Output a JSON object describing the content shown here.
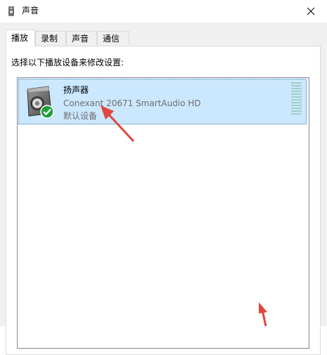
{
  "window": {
    "title": "声音"
  },
  "tabs": [
    {
      "label": "播放",
      "active": true
    },
    {
      "label": "录制",
      "active": false
    },
    {
      "label": "声音",
      "active": false
    },
    {
      "label": "通信",
      "active": false
    }
  ],
  "playback": {
    "instruction": "选择以下播放设备来修改设置:",
    "devices": [
      {
        "name": "扬声器",
        "driver": "Conexant 20671 SmartAudio HD",
        "status": "默认设备",
        "icon": "speaker-icon",
        "status_icon": "checkmark-icon",
        "selected": true
      }
    ]
  },
  "colors": {
    "selection_bg": "#cce8ff",
    "default_badge": "#1f9e3e",
    "annotation_arrow": "#e0463d"
  }
}
